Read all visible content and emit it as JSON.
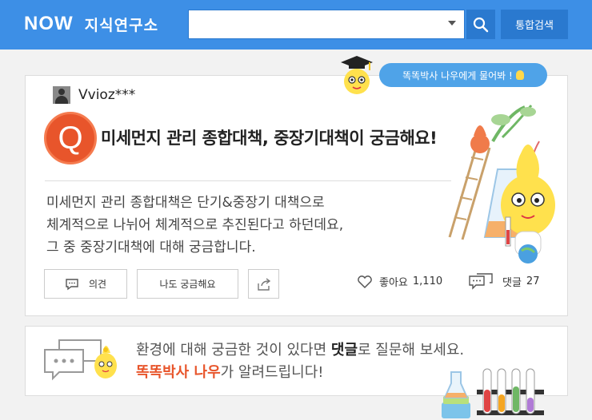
{
  "header": {
    "logo": "NOW",
    "title": "지식연구소",
    "search_value": "",
    "search_button_icon": "search-icon",
    "total_search_label": "통합검색"
  },
  "mascot_bubble": "똑똑박사 나우에게 물어봐 !",
  "question": {
    "user_name": "Vvioz***",
    "badge": "Q",
    "title": "미세먼지 관리 종합대책, 중장기대책이 궁금해요!",
    "body_lines": [
      "미세먼지 관리 종합대책은 단기&중장기 대책으로",
      "체계적으로 나뉘어 체계적으로 추진된다고 하던데요,",
      "그 중 중장기대책에 대해 궁금합니다."
    ],
    "actions": {
      "opinion_label": "의견",
      "curious_label": "나도 궁금해요",
      "share_icon": "share-icon"
    },
    "stats": {
      "like_label": "좋아요",
      "like_count": "1,110",
      "comment_label": "댓글",
      "comment_count": "27"
    }
  },
  "bottom_banner": {
    "line1_part1": "환경에 대해 궁금한 것이 있다면 ",
    "line1_strong": "댓글",
    "line1_part2": "로 질문해 보세요.",
    "line2_accent": "똑똑박사 나우",
    "line2_part": "가 알려드립니다!"
  },
  "colors": {
    "header_blue": "#3d8fe6",
    "button_blue": "#2a79cf",
    "q_orange": "#e8552b",
    "bubble_blue": "#4fa3e8"
  }
}
